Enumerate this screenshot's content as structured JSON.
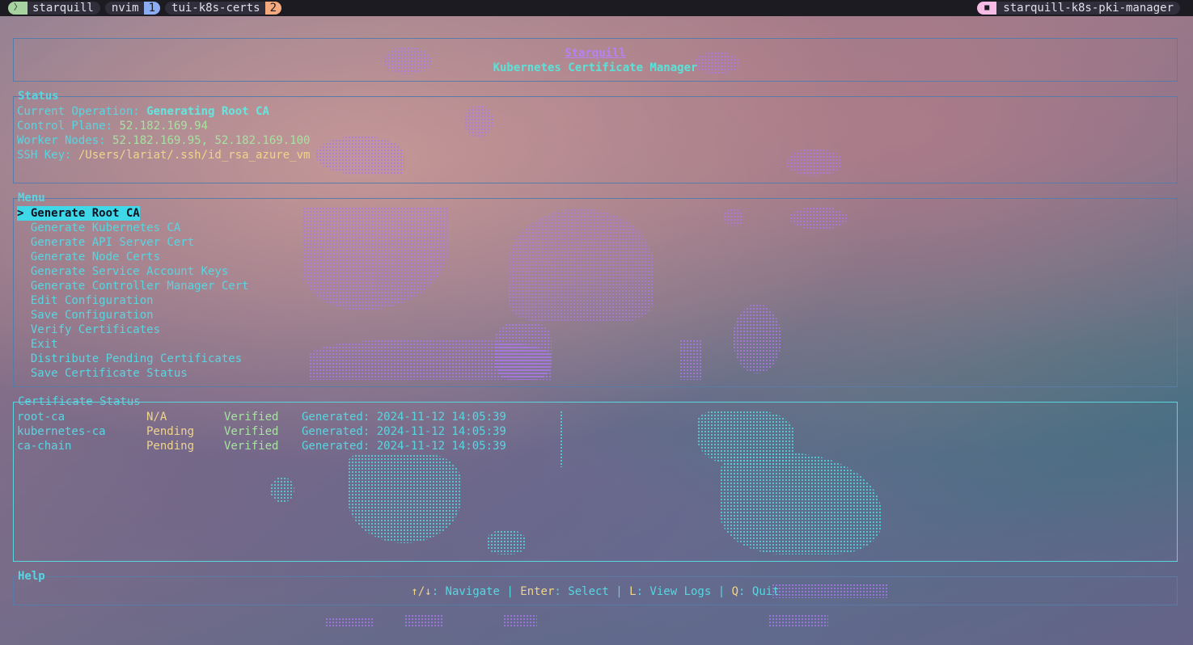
{
  "tmux": {
    "session_icon": "terminal-icon",
    "session_name": "starquill",
    "windows": [
      {
        "name": "nvim",
        "index": "1"
      },
      {
        "name": "tui-k8s-certs",
        "index": "2"
      }
    ],
    "host_icon": "folder-icon",
    "host_name": "starquill-k8s-pki-manager"
  },
  "header": {
    "title": "Starquill",
    "subtitle": "Kubernetes Certificate Manager"
  },
  "status": {
    "title": "Status",
    "current_operation_label": "Current Operation: ",
    "current_operation": "Generating Root CA",
    "control_plane_label": "Control Plane: ",
    "control_plane": "52.182.169.94",
    "worker_nodes_label": "Worker Nodes: ",
    "worker_nodes": "52.182.169.95, 52.182.169.100",
    "ssh_key_label": "SSH Key: ",
    "ssh_key": "/Users/lariat/.ssh/id_rsa_azure_vm"
  },
  "menu": {
    "title": "Menu",
    "items": [
      "> Generate Root CA",
      "  Generate Kubernetes CA",
      "  Generate API Server Cert",
      "  Generate Node Certs",
      "  Generate Service Account Keys",
      "  Generate Controller Manager Cert",
      "  Edit Configuration",
      "  Save Configuration",
      "  Verify Certificates",
      "  Exit",
      "  Distribute Pending Certificates",
      "  Save Certificate Status"
    ]
  },
  "certificates": {
    "title": "Certificate Status",
    "rows": [
      {
        "name": "root-ca",
        "state": "N/A",
        "verified": "Verified",
        "generated": "Generated: 2024-11-12 14:05:39"
      },
      {
        "name": "kubernetes-ca",
        "state": "Pending",
        "verified": "Verified",
        "generated": "Generated: 2024-11-12 14:05:39"
      },
      {
        "name": "ca-chain",
        "state": "Pending",
        "verified": "Verified",
        "generated": "Generated: 2024-11-12 14:05:39"
      }
    ]
  },
  "help": {
    "title": "Help",
    "nav_key": "↑/↓",
    "nav_desc": ": Navigate | ",
    "enter_key": "Enter",
    "enter_desc": ": Select | ",
    "logs_key": "L",
    "logs_desc": ": View Logs | ",
    "quit_key": "Q",
    "quit_desc": ": Quit"
  },
  "colors": {
    "accent_cyan": "#59d5e0",
    "title_purple": "#b681f2",
    "value_green": "#a6e3a1",
    "value_yellow": "#f0d48a",
    "selection_bg": "#3fd8e8"
  }
}
